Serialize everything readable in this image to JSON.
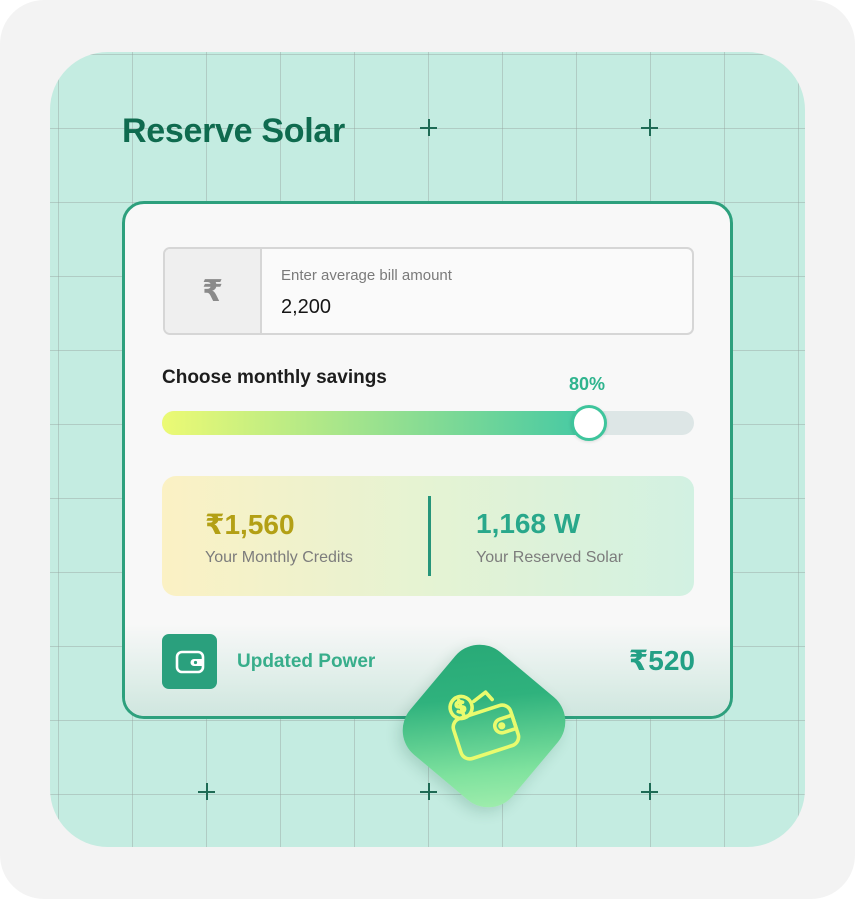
{
  "title": "Reserve Solar",
  "bill": {
    "currency_symbol": "₹",
    "label": "Enter average bill amount",
    "value": "2,200"
  },
  "savings": {
    "label": "Choose monthly savings",
    "percent_label": "80%",
    "percent_value": 0.8
  },
  "stats": {
    "credits_value": "₹1,560",
    "credits_label": "Your Monthly Credits",
    "solar_value": "1,168 W",
    "solar_label": "Your Reserved Solar"
  },
  "updated": {
    "icon": "wallet-icon",
    "label": "Updated Power",
    "value": "₹520"
  },
  "badge": {
    "icon": "wallet-coin-icon"
  },
  "colors": {
    "brand": "#0f6b4f",
    "accent": "#2da07d",
    "credits": "#b3a015",
    "solar": "#29a88b"
  }
}
